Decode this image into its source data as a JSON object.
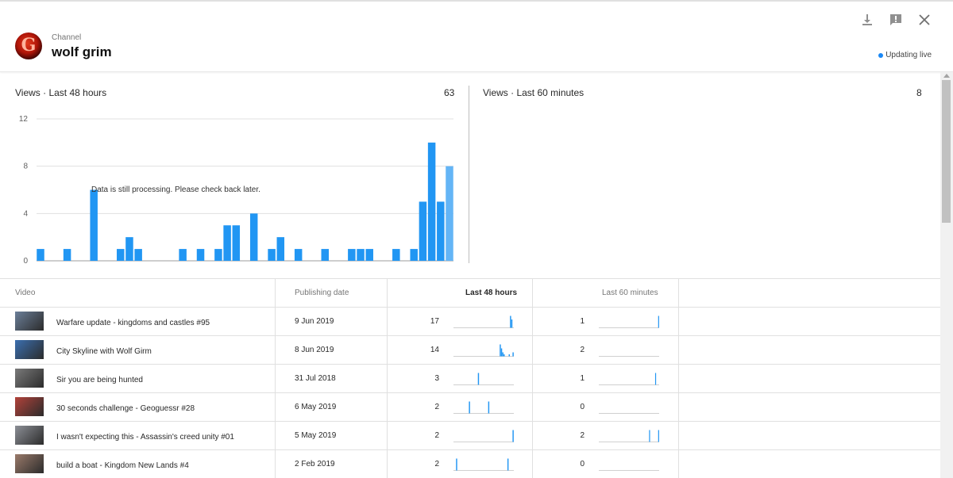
{
  "header": {
    "channel_label": "Channel",
    "channel_name": "wolf grim",
    "avatar_letter": "G",
    "live_label": "Updating live",
    "icons": [
      "download-icon",
      "feedback-icon",
      "close-icon"
    ]
  },
  "panels": {
    "left": {
      "title": "Views · Last 48 hours",
      "total": "63",
      "processing_note": "Data is still processing. Please check back later."
    },
    "right": {
      "title": "Views · Last 60 minutes",
      "total": "8"
    }
  },
  "chart_data": {
    "type": "bar",
    "title": "Views · Last 48 hours",
    "xlabel": "",
    "ylabel": "",
    "ylim": [
      0,
      12
    ],
    "yticks": [
      "0",
      "4",
      "8",
      "12"
    ],
    "grid": true,
    "values": [
      1,
      0,
      0,
      1,
      0,
      0,
      6,
      0,
      0,
      1,
      2,
      1,
      0,
      0,
      0,
      0,
      1,
      0,
      1,
      0,
      1,
      3,
      3,
      0,
      4,
      0,
      1,
      2,
      0,
      1,
      0,
      0,
      1,
      0,
      0,
      1,
      1,
      1,
      0,
      0,
      1,
      0,
      1,
      5,
      10,
      5,
      8
    ],
    "last_bar_partial": true,
    "colors": {
      "bar": "#2196f3",
      "bar_partial": "#64b5f6",
      "grid": "#e0e0e0"
    }
  },
  "table": {
    "headers": {
      "video": "Video",
      "date": "Publishing date",
      "last48": "Last 48 hours",
      "last60": "Last 60 minutes"
    },
    "rows": [
      {
        "title": "Warfare update - kingdoms and castles #95",
        "date": "9 Jun 2019",
        "last48": "17",
        "last60": "1",
        "spark48": [
          0,
          0,
          0,
          0,
          0,
          0,
          0,
          0,
          0,
          0,
          0,
          0,
          0,
          0,
          0,
          0,
          0,
          0,
          0,
          0,
          0,
          0,
          0,
          0,
          0,
          0,
          0,
          0,
          0,
          0,
          0,
          0,
          0,
          0,
          0,
          14,
          17,
          0,
          0,
          0,
          0,
          0,
          0,
          0,
          0,
          0,
          0
        ],
        "spark60": [
          0,
          0,
          0,
          0,
          0,
          0,
          0,
          0,
          0,
          0,
          0,
          0,
          0,
          0,
          0,
          0,
          0,
          0,
          0,
          0,
          0,
          0,
          0,
          0,
          0,
          0,
          0,
          0,
          0,
          0,
          0,
          0,
          0,
          0,
          0,
          0,
          0,
          0,
          0,
          0,
          0,
          0,
          0,
          0,
          0,
          0,
          0,
          0,
          0,
          0,
          0,
          0,
          0,
          0,
          0,
          0,
          0,
          0,
          0,
          1
        ]
      },
      {
        "title": "City Skyline with Wolf Girm",
        "date": "8 Jun 2019",
        "last48": "14",
        "last60": "2",
        "spark48": [
          0,
          0,
          0,
          0,
          0,
          0,
          0,
          0,
          0,
          0,
          0,
          0,
          0,
          0,
          0,
          0,
          0,
          0,
          0,
          0,
          0,
          0,
          0,
          0,
          0,
          0,
          0,
          0,
          0,
          0,
          0,
          0,
          0,
          0,
          0,
          0,
          0,
          0,
          0,
          0,
          0,
          0,
          0,
          0,
          0,
          0,
          0
        ],
        "spark60": [
          0,
          0,
          0,
          0,
          0,
          0,
          0,
          0,
          0,
          0,
          0,
          0,
          0,
          0,
          0,
          0,
          0,
          0,
          0,
          0,
          0,
          0,
          0,
          0,
          0,
          0,
          0,
          0,
          0,
          0,
          0,
          0,
          0,
          0,
          0,
          0,
          0,
          0,
          0,
          0,
          0,
          0,
          0,
          0,
          0,
          0,
          0,
          0,
          0,
          0,
          0,
          0,
          0,
          0,
          0,
          0,
          0,
          0,
          0,
          0
        ]
      },
      {
        "title": "Sir you are being hunted",
        "date": "31 Jul 2018",
        "last48": "3",
        "last60": "1"
      },
      {
        "title": "30 seconds challenge - Geoguessr #28",
        "date": "6 May 2019",
        "last48": "2",
        "last60": "0"
      },
      {
        "title": "I wasn't expecting this - Assassin's creed unity #01",
        "date": "5 May 2019",
        "last48": "2",
        "last60": "2"
      },
      {
        "title": "build a boat - Kingdom New Lands #4",
        "date": "2 Feb 2019",
        "last48": "2",
        "last60": "0"
      }
    ],
    "sparklines48": [
      [
        0,
        0,
        0,
        0,
        0,
        0,
        0,
        0,
        0,
        0,
        0,
        0,
        0,
        0,
        0,
        0,
        0,
        0,
        0,
        0,
        0,
        0,
        0,
        0,
        0,
        0,
        0,
        0,
        0,
        0,
        0,
        0,
        0,
        0,
        0,
        0,
        0,
        0,
        0,
        0,
        0,
        0,
        0,
        0,
        10,
        7,
        0
      ],
      [
        0,
        0,
        0,
        0,
        0,
        0,
        0,
        0,
        0,
        0,
        0,
        0,
        0,
        0,
        0,
        0,
        0,
        0,
        0,
        0,
        0,
        0,
        0,
        0,
        0,
        0,
        0,
        0,
        0,
        0,
        0,
        0,
        0,
        0,
        0,
        0,
        6,
        4,
        2,
        1,
        0,
        0,
        0,
        1,
        0,
        0,
        2
      ],
      [
        0,
        0,
        0,
        0,
        0,
        0,
        0,
        0,
        0,
        0,
        0,
        0,
        0,
        0,
        0,
        0,
        0,
        0,
        0,
        1,
        0,
        0,
        0,
        0,
        0,
        0,
        0,
        0,
        0,
        0,
        0,
        0,
        0,
        0,
        0,
        0,
        0,
        0,
        0,
        0,
        0,
        0,
        0,
        0,
        0,
        0,
        0
      ],
      [
        0,
        0,
        0,
        0,
        0,
        0,
        0,
        0,
        0,
        0,
        0,
        0,
        1,
        0,
        0,
        0,
        0,
        0,
        0,
        0,
        0,
        0,
        0,
        0,
        0,
        0,
        0,
        1,
        0,
        0,
        0,
        0,
        0,
        0,
        0,
        0,
        0,
        0,
        0,
        0,
        0,
        0,
        0,
        0,
        0,
        0,
        0
      ],
      [
        0,
        0,
        0,
        0,
        0,
        0,
        0,
        0,
        0,
        0,
        0,
        0,
        0,
        0,
        0,
        0,
        0,
        0,
        0,
        0,
        0,
        0,
        0,
        0,
        0,
        0,
        0,
        0,
        0,
        0,
        0,
        0,
        0,
        0,
        0,
        0,
        0,
        0,
        0,
        0,
        0,
        0,
        0,
        0,
        0,
        0,
        1
      ],
      [
        0,
        0,
        1,
        0,
        0,
        0,
        0,
        0,
        0,
        0,
        0,
        0,
        0,
        0,
        0,
        0,
        0,
        0,
        0,
        0,
        0,
        0,
        0,
        0,
        0,
        0,
        0,
        0,
        0,
        0,
        0,
        0,
        0,
        0,
        0,
        0,
        0,
        0,
        0,
        0,
        0,
        0,
        1,
        0,
        0,
        0,
        0
      ]
    ],
    "sparklines60": [
      [
        0,
        0,
        0,
        0,
        0,
        0,
        0,
        0,
        0,
        0,
        0,
        0,
        0,
        0,
        0,
        0,
        0,
        0,
        0,
        0,
        0,
        0,
        0,
        0,
        0,
        0,
        0,
        0,
        0,
        0,
        0,
        0,
        0,
        0,
        0,
        0,
        0,
        0,
        0,
        0,
        0,
        0,
        0,
        0,
        0,
        0,
        0,
        0,
        0,
        0,
        0,
        0,
        0,
        0,
        0,
        0,
        0,
        0,
        0,
        1
      ],
      [
        0,
        0,
        0,
        0,
        0,
        0,
        0,
        0,
        0,
        0,
        0,
        0,
        0,
        0,
        0,
        0,
        0,
        0,
        0,
        0,
        0,
        0,
        0,
        0,
        0,
        0,
        0,
        0,
        0,
        0,
        0,
        0,
        0,
        0,
        0,
        0,
        0,
        0,
        0,
        0,
        0,
        0,
        0,
        0,
        0,
        0,
        0,
        0,
        0,
        0,
        0,
        0,
        0,
        0,
        0,
        0,
        0,
        0,
        0,
        0
      ],
      [
        0,
        0,
        0,
        0,
        0,
        0,
        0,
        0,
        0,
        0,
        0,
        0,
        0,
        0,
        0,
        0,
        0,
        0,
        0,
        0,
        0,
        0,
        0,
        0,
        0,
        0,
        0,
        0,
        0,
        0,
        0,
        0,
        0,
        0,
        0,
        0,
        0,
        0,
        0,
        0,
        0,
        0,
        0,
        0,
        0,
        0,
        0,
        0,
        0,
        0,
        0,
        0,
        0,
        0,
        0,
        0,
        1,
        0,
        0,
        0
      ],
      [
        0,
        0,
        0,
        0,
        0,
        0,
        0,
        0,
        0,
        0,
        0,
        0,
        0,
        0,
        0,
        0,
        0,
        0,
        0,
        0,
        0,
        0,
        0,
        0,
        0,
        0,
        0,
        0,
        0,
        0,
        0,
        0,
        0,
        0,
        0,
        0,
        0,
        0,
        0,
        0,
        0,
        0,
        0,
        0,
        0,
        0,
        0,
        0,
        0,
        0,
        0,
        0,
        0,
        0,
        0,
        0,
        0,
        0,
        0,
        0
      ],
      [
        0,
        0,
        0,
        0,
        0,
        0,
        0,
        0,
        0,
        0,
        0,
        0,
        0,
        0,
        0,
        0,
        0,
        0,
        0,
        0,
        0,
        0,
        0,
        0,
        0,
        0,
        0,
        0,
        0,
        0,
        0,
        0,
        0,
        0,
        0,
        0,
        0,
        0,
        0,
        0,
        0,
        0,
        0,
        0,
        0,
        0,
        0,
        0,
        0,
        0,
        1,
        0,
        0,
        0,
        0,
        0,
        0,
        0,
        0,
        1
      ],
      [
        0,
        0,
        0,
        0,
        0,
        0,
        0,
        0,
        0,
        0,
        0,
        0,
        0,
        0,
        0,
        0,
        0,
        0,
        0,
        0,
        0,
        0,
        0,
        0,
        0,
        0,
        0,
        0,
        0,
        0,
        0,
        0,
        0,
        0,
        0,
        0,
        0,
        0,
        0,
        0,
        0,
        0,
        0,
        0,
        0,
        0,
        0,
        0,
        0,
        0,
        0,
        0,
        0,
        0,
        0,
        0,
        0,
        0,
        0,
        0
      ]
    ],
    "thumb_colors": [
      "#6b7f99",
      "#3b6fb0",
      "#7a7a7a",
      "#b2423a",
      "#8c8f96",
      "#9a7a6a"
    ]
  }
}
